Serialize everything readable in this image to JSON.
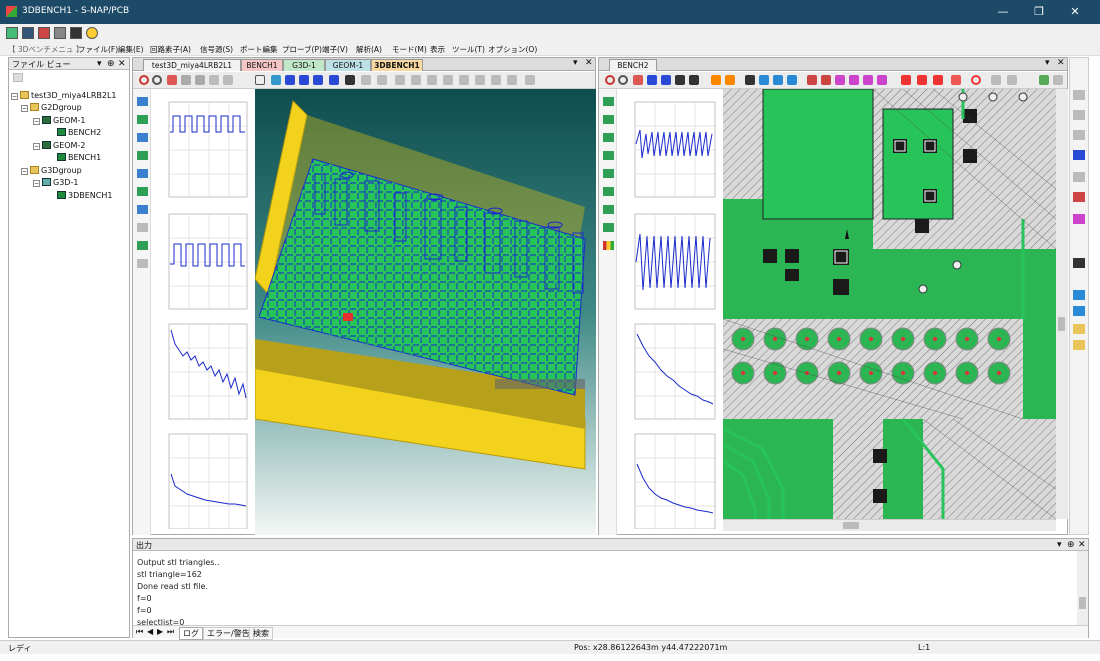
{
  "window": {
    "title": "3DBENCH1 - S-NAP/PCB",
    "minimize": "—",
    "restore": "❐",
    "close": "✕"
  },
  "menu": [
    "【 3Dベンチメニュ 】",
    "ファイル(F)",
    "編集(E)",
    "回路素子(A)",
    "信号源(S)",
    "ポート編集",
    "プローブ(P)",
    "端子(V)",
    "解析(A)",
    "モード(M)",
    "表示",
    "ツール(T)",
    "オプション(O)"
  ],
  "file_view": {
    "title": "ファイル ビュー",
    "tree": {
      "root": "test3D_miya4LRB2L1",
      "g2d": "G2Dgroup",
      "geom1": "GEOM-1",
      "bench2": "BENCH2",
      "geom2": "GEOM-2",
      "bench1": "BENCH1",
      "g3d": "G3Dgroup",
      "g3d1": "G3D-1",
      "bench3d": "3DBENCH1"
    }
  },
  "left_tabs": [
    "test3D_miya4LRB2L1",
    "BENCH1",
    "G3D-1",
    "GEOM-1",
    "3DBENCH1"
  ],
  "left_active_tab": "3DBENCH1",
  "right_tabs": [
    "BENCH2"
  ],
  "output": {
    "title": "出力",
    "lines": [
      "Output stl triangles..",
      "stl triangle=162",
      "Done read stl file.",
      "f=0",
      "f=0",
      "selectlist=0"
    ],
    "tabs": [
      "ログ",
      "エラー/警告",
      "検索"
    ]
  },
  "status": {
    "left": "レディ",
    "pos": "Pos: x28.86122643m y44.47222071m",
    "layer": "L:1"
  },
  "colors": {
    "trace": "#1a2acc",
    "board": "#27c45a",
    "chassis": "#f2d21c",
    "titlebar": "#1c4a67"
  }
}
